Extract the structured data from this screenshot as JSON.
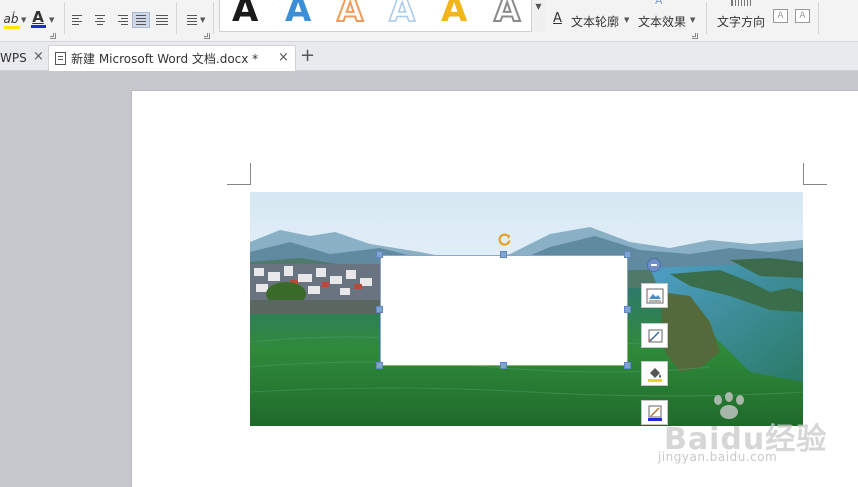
{
  "ribbon": {
    "highlight_icon": "highlight-pen-icon",
    "font_color_icon": "font-color-icon",
    "font_color_glyph": "A",
    "highlight_glyph": "aḃ",
    "style_samples": [
      "A",
      "A",
      "A",
      "A",
      "A",
      "A"
    ],
    "text_outline_label": "文本轮廓",
    "text_effect_label": "文本效果",
    "text_direction_label": "文字方向",
    "colors": {
      "sample_black": "#1a1a1a",
      "sample_blue": "#3c8fd6",
      "sample_orange": "#f39a5a",
      "sample_light_blue": "#a8c8ec",
      "sample_gold": "#f2b61c",
      "sample_gray": "#8a8a8a",
      "font_color_bar": "#1c2bd8",
      "highlight_bar": "#ffe600"
    }
  },
  "tabs": [
    {
      "label": "WPS",
      "active": false
    },
    {
      "label": "新建 Microsoft Word 文档.docx *",
      "active": true
    }
  ],
  "new_tab_glyph": "+",
  "close_glyph": "×",
  "watermark": {
    "logo": "Baidu经验",
    "url": "jingyan.baidu.com"
  }
}
